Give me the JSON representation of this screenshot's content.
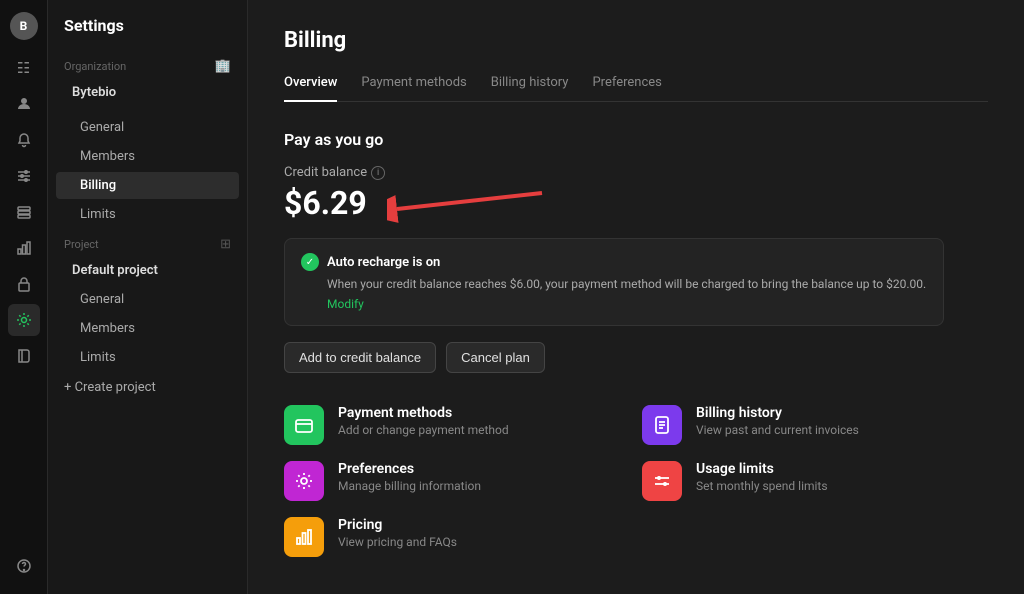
{
  "app": {
    "title": "Settings"
  },
  "rail": {
    "avatar": "B",
    "icons": [
      {
        "name": "grid-icon",
        "symbol": "⊞",
        "active": false
      },
      {
        "name": "user-icon",
        "symbol": "👤",
        "active": false
      },
      {
        "name": "bell-icon",
        "symbol": "🔔",
        "active": false
      },
      {
        "name": "sliders-icon",
        "symbol": "⇄",
        "active": false
      },
      {
        "name": "layers-icon",
        "symbol": "▤",
        "active": false
      },
      {
        "name": "chart-icon",
        "symbol": "📊",
        "active": false
      },
      {
        "name": "lock-icon",
        "symbol": "🔒",
        "active": false
      },
      {
        "name": "settings-icon",
        "symbol": "⚙",
        "active": true
      },
      {
        "name": "book-icon",
        "symbol": "📘",
        "active": false
      }
    ],
    "bottom_icons": [
      {
        "name": "help-icon",
        "symbol": "?"
      }
    ]
  },
  "sidebar": {
    "title": "Settings",
    "organization_label": "Organization",
    "organization_icon": "🏢",
    "org_items": [
      {
        "label": "General",
        "active": false
      },
      {
        "label": "Members",
        "active": false
      },
      {
        "label": "Billing",
        "active": true
      },
      {
        "label": "Limits",
        "active": false
      }
    ],
    "project_label": "Project",
    "project_icon": "⊞",
    "project_name": "Default project",
    "project_items": [
      {
        "label": "General",
        "active": false
      },
      {
        "label": "Members",
        "active": false
      },
      {
        "label": "Limits",
        "active": false
      }
    ],
    "create_project": "+ Create project"
  },
  "billing": {
    "page_title": "Billing",
    "tabs": [
      {
        "label": "Overview",
        "active": true
      },
      {
        "label": "Payment methods",
        "active": false
      },
      {
        "label": "Billing history",
        "active": false
      },
      {
        "label": "Preferences",
        "active": false
      }
    ],
    "section_heading": "Pay as you go",
    "credit_label": "Credit balance",
    "credit_amount": "$6.29",
    "recharge": {
      "title": "Auto recharge is on",
      "description": "When your credit balance reaches $6.00, your payment method will be charged to bring the balance up to $20.00.",
      "link": "Modify"
    },
    "buttons": [
      {
        "label": "Add to credit balance",
        "name": "add-credit-button"
      },
      {
        "label": "Cancel plan",
        "name": "cancel-plan-button"
      }
    ],
    "cards": [
      {
        "name": "payment-methods-card",
        "icon": "💳",
        "icon_color": "green",
        "title": "Payment methods",
        "description": "Add or change payment method"
      },
      {
        "name": "billing-history-card",
        "icon": "📄",
        "icon_color": "purple",
        "title": "Billing history",
        "description": "View past and current invoices"
      },
      {
        "name": "preferences-card",
        "icon": "⚙",
        "icon_color": "pink",
        "title": "Preferences",
        "description": "Manage billing information"
      },
      {
        "name": "usage-limits-card",
        "icon": "⇄",
        "icon_color": "red",
        "title": "Usage limits",
        "description": "Set monthly spend limits"
      },
      {
        "name": "pricing-card",
        "icon": "📊",
        "icon_color": "orange",
        "title": "Pricing",
        "description": "View pricing and FAQs"
      }
    ]
  }
}
